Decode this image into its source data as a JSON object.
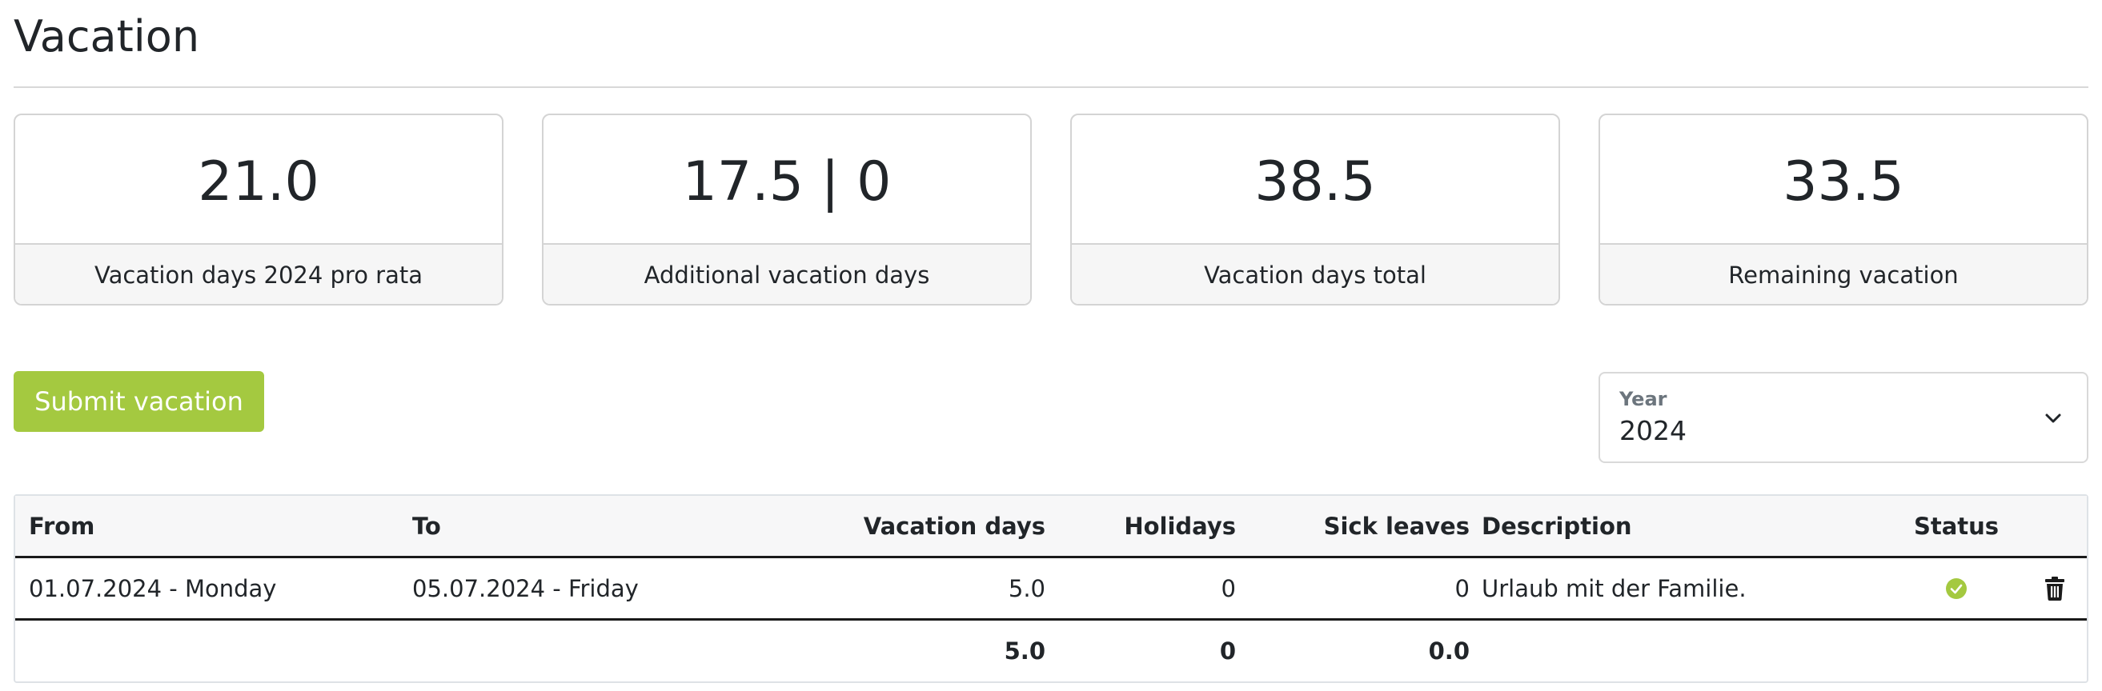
{
  "page": {
    "title": "Vacation"
  },
  "cards": [
    {
      "value": "21.0",
      "label": "Vacation days 2024 pro rata"
    },
    {
      "value": "17.5 | 0",
      "label": "Additional vacation days"
    },
    {
      "value": "38.5",
      "label": "Vacation days total"
    },
    {
      "value": "33.5",
      "label": "Remaining vacation"
    }
  ],
  "actions": {
    "submit_label": "Submit vacation"
  },
  "year_filter": {
    "label": "Year",
    "value": "2024",
    "icon": "chevron-down-icon"
  },
  "table": {
    "headers": {
      "from": "From",
      "to": "To",
      "vacation_days": "Vacation days",
      "holidays": "Holidays",
      "sick_leaves": "Sick leaves",
      "description": "Description",
      "status": "Status"
    },
    "rows": [
      {
        "from": "01.07.2024 - Monday",
        "to": "05.07.2024 - Friday",
        "vacation_days": "5.0",
        "holidays": "0",
        "sick_leaves": "0",
        "description": "Urlaub mit der Familie.",
        "status_icon": "check-circle-icon",
        "delete_icon": "trash-icon"
      }
    ],
    "totals": {
      "vacation_days": "5.0",
      "holidays": "0",
      "sick_leaves": "0.0"
    }
  },
  "colors": {
    "accent": "#a4c940",
    "status_approved": "#a4c940"
  }
}
